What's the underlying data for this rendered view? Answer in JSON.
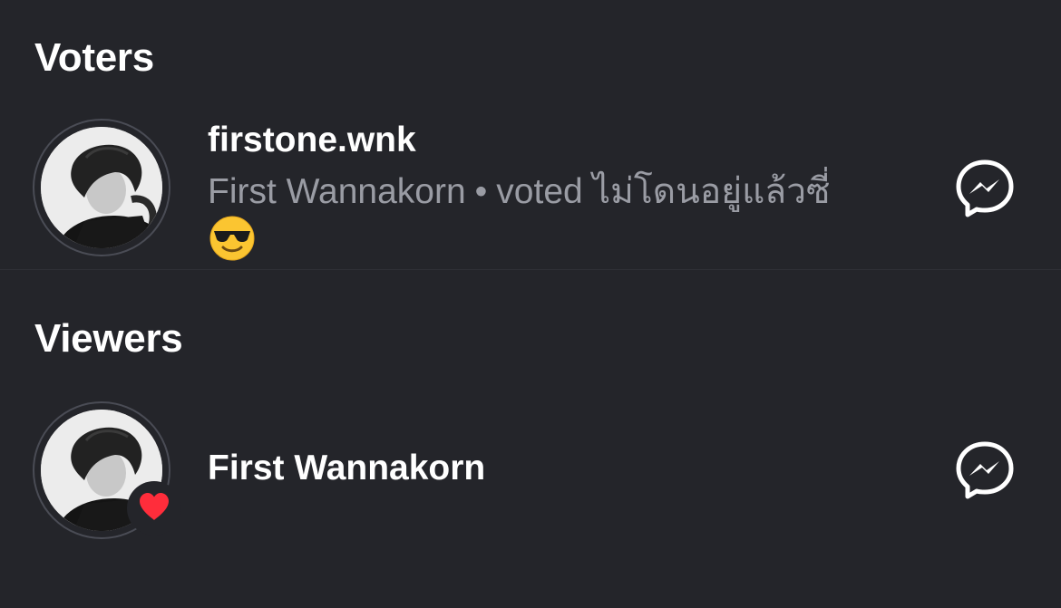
{
  "voters": {
    "title": "Voters",
    "items": [
      {
        "username": "firstone.wnk",
        "display_name": "First Wannakorn",
        "separator": "•",
        "vote_text": "voted ไม่โดนอยู่แล้วซี่",
        "emoji": "smiling-face-with-sunglasses",
        "action_icon": "messenger-icon"
      }
    ]
  },
  "viewers": {
    "title": "Viewers",
    "items": [
      {
        "display_name": "First Wannakorn",
        "badge": "heart-icon",
        "action_icon": "messenger-icon"
      }
    ]
  },
  "colors": {
    "background": "#24252a",
    "text_primary": "#ffffff",
    "text_secondary": "#9a9ca4",
    "heart": "#ff2d3b"
  }
}
